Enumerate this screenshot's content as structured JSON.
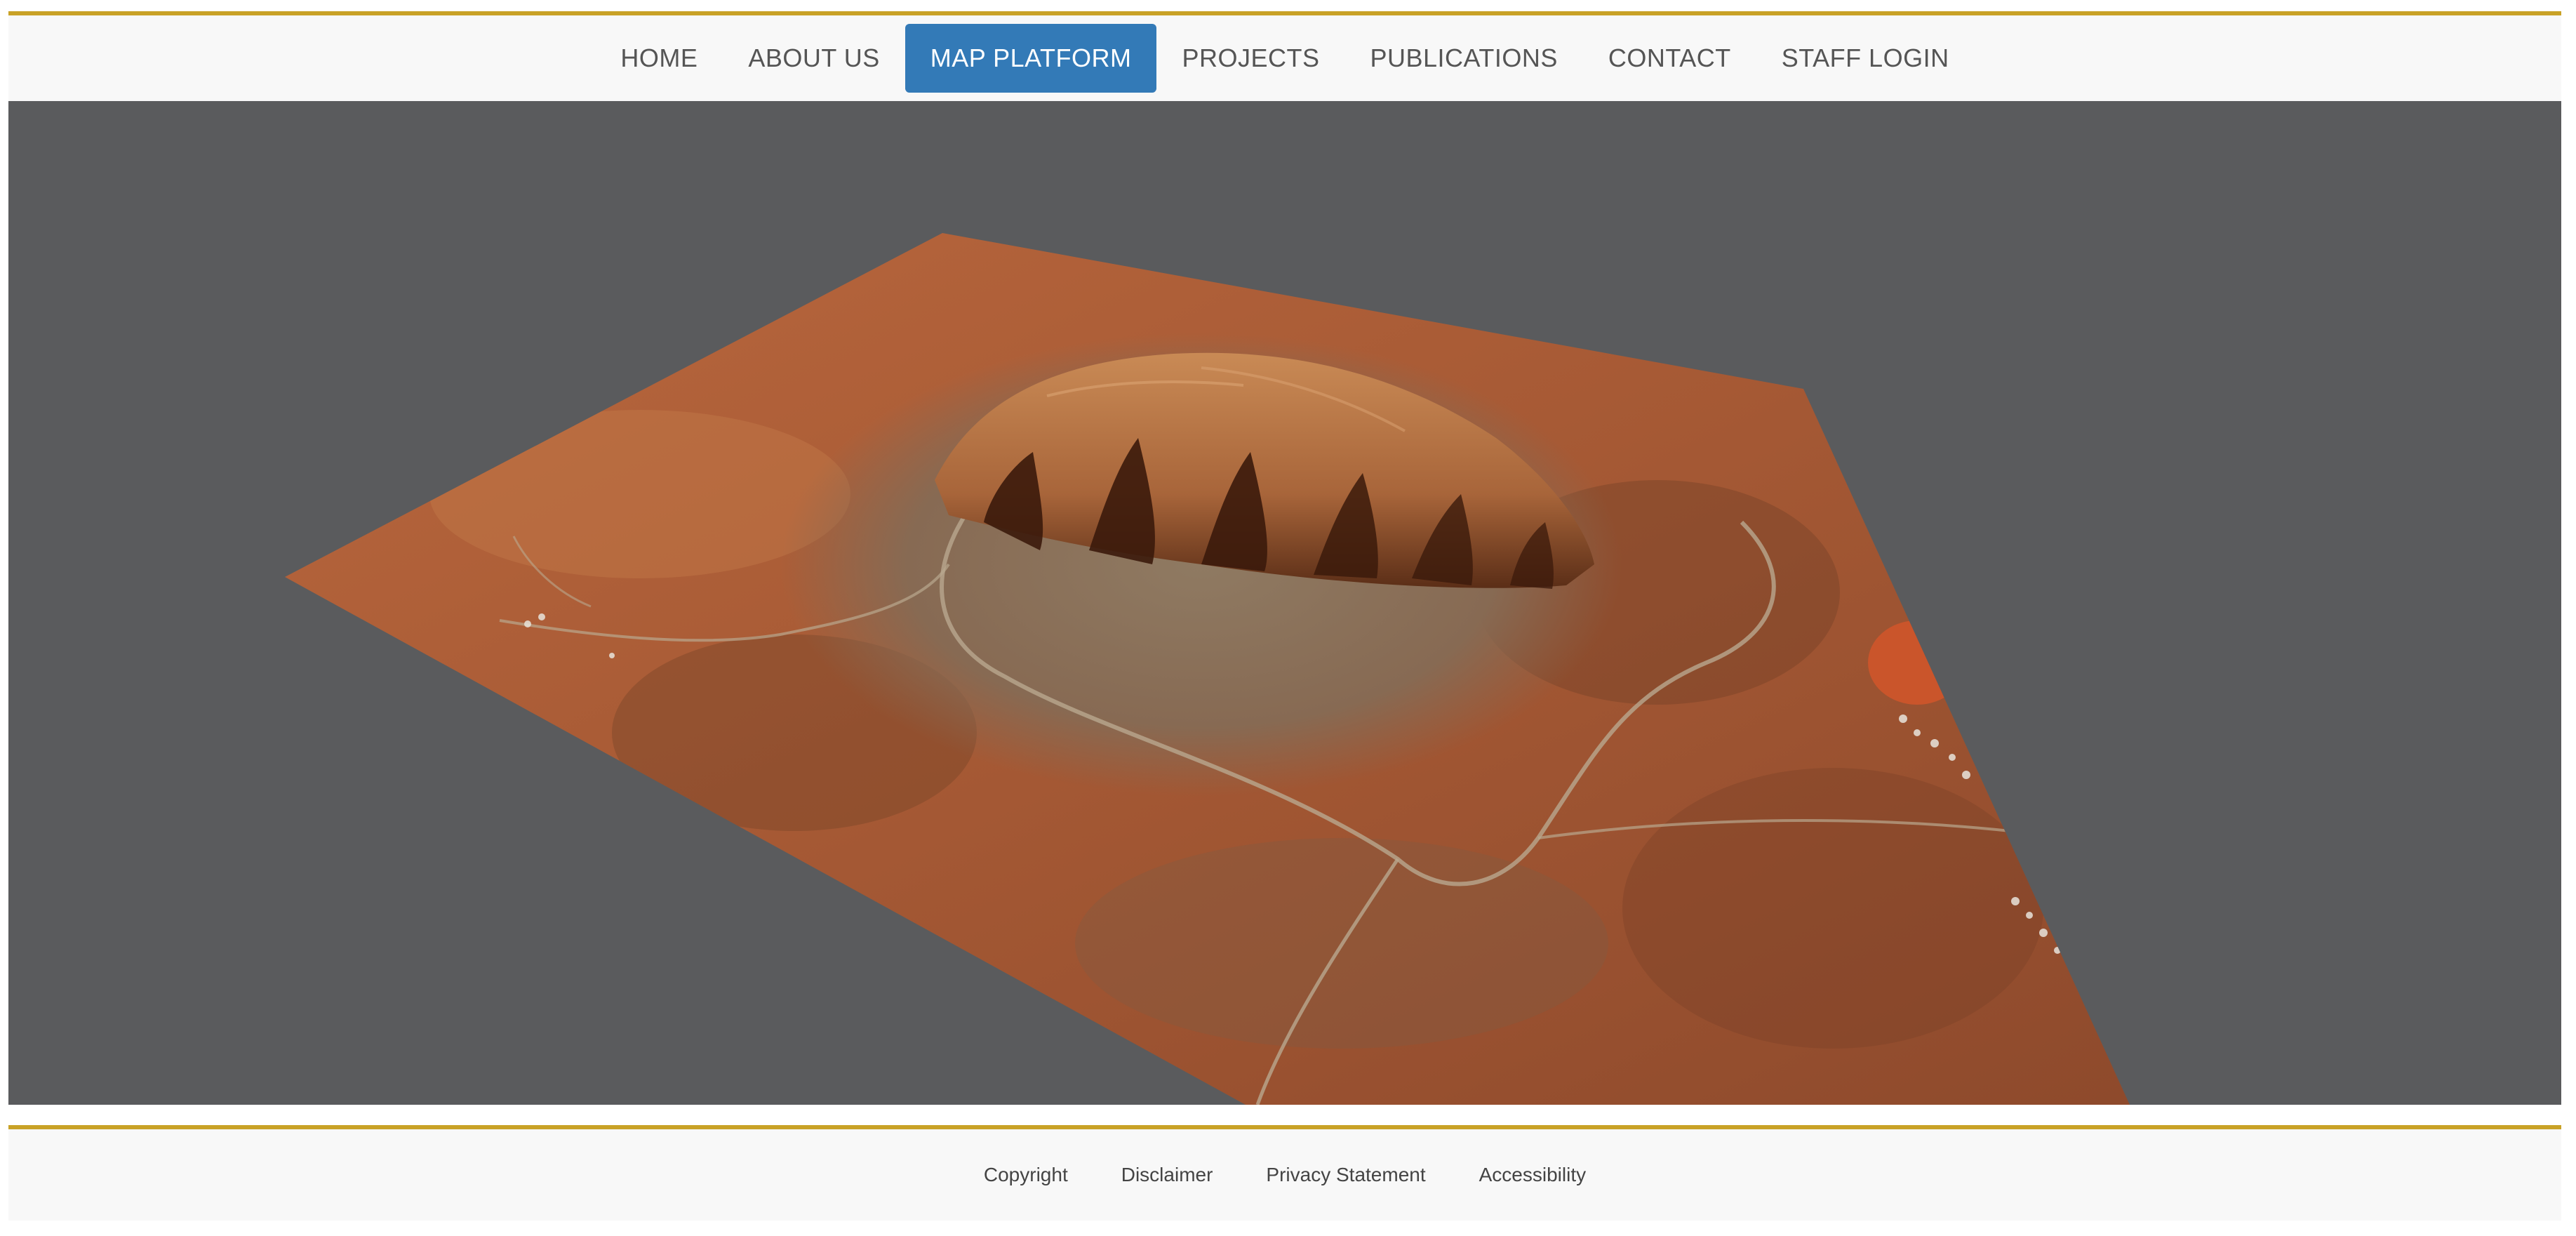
{
  "theme": {
    "accent": "#337ab7",
    "rule_color": "#c9a227",
    "map_background": "#5a5b5d"
  },
  "nav": {
    "items": [
      {
        "label": "HOME",
        "active": false
      },
      {
        "label": "ABOUT US",
        "active": false
      },
      {
        "label": "MAP PLATFORM",
        "active": true
      },
      {
        "label": "PROJECTS",
        "active": false
      },
      {
        "label": "PUBLICATIONS",
        "active": false
      },
      {
        "label": "CONTACT",
        "active": false
      },
      {
        "label": "STAFF LOGIN",
        "active": false
      }
    ]
  },
  "footer": {
    "links": [
      "Copyright",
      "Disclaimer",
      "Privacy Statement",
      "Accessibility"
    ]
  }
}
